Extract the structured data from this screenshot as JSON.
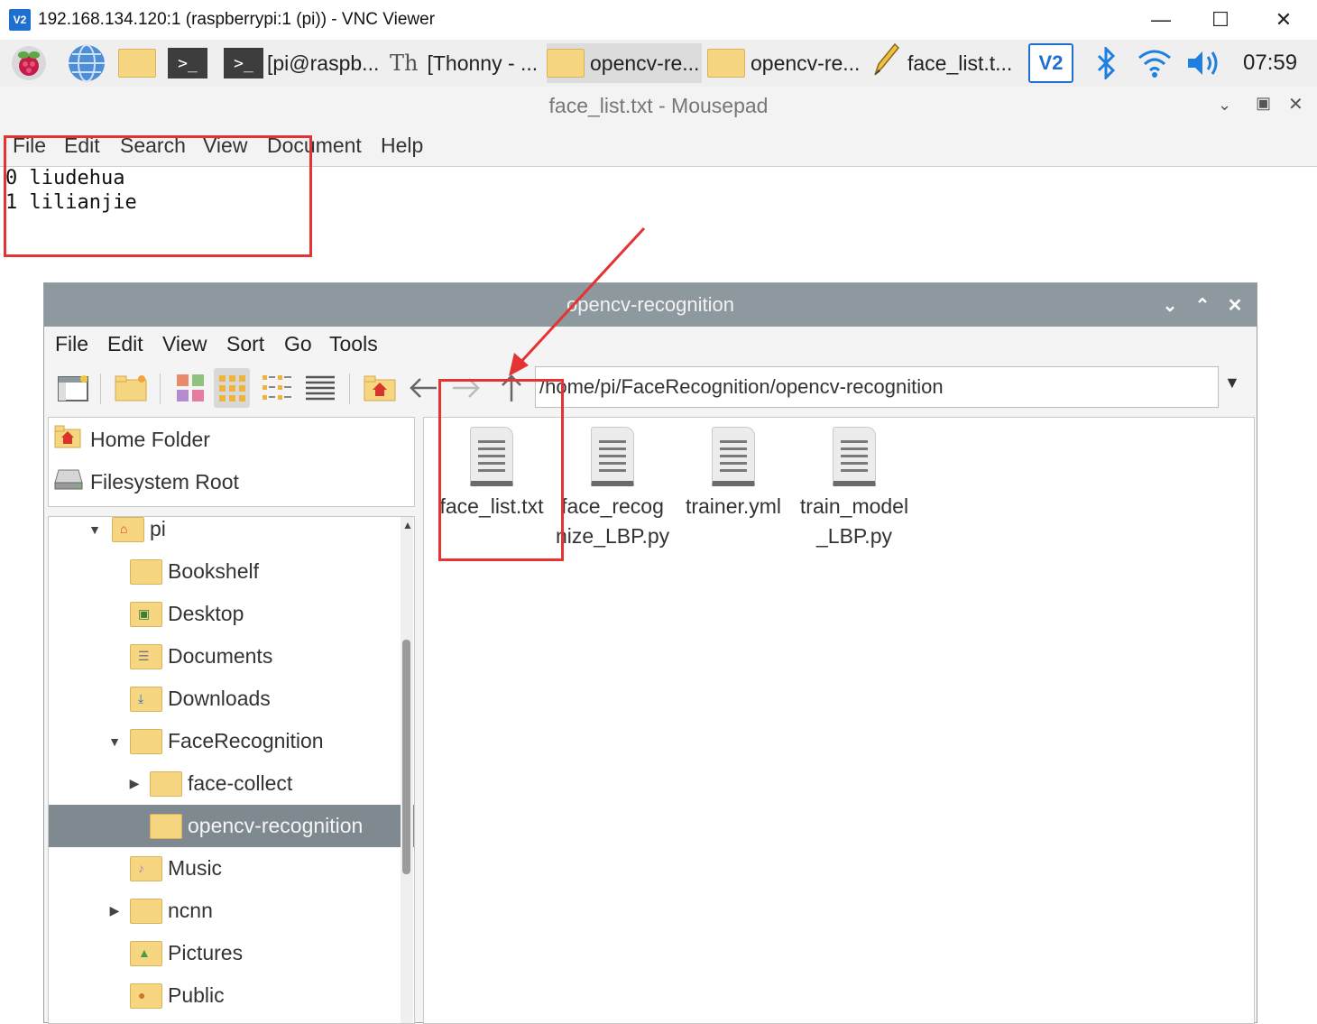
{
  "vnc": {
    "logo": "V2",
    "title": "192.168.134.120:1 (raspberrypi:1 (pi)) - VNC Viewer",
    "controls": [
      "minimize",
      "maximize",
      "close"
    ]
  },
  "taskbar": {
    "tasks": [
      {
        "label": "[pi@raspb...",
        "icon": "terminal-icon"
      },
      {
        "label": "[Thonny  - ...",
        "icon": "thonny-icon"
      },
      {
        "label": "opencv-re...",
        "icon": "folder-icon"
      },
      {
        "label": "opencv-re...",
        "icon": "folder-icon"
      },
      {
        "label": "face_list.t...",
        "icon": "pencil-icon"
      }
    ],
    "clock": "07:59"
  },
  "mousepad": {
    "title": "face_list.txt - Mousepad",
    "menu": [
      "File",
      "Edit",
      "Search",
      "View",
      "Document",
      "Help"
    ],
    "lines": [
      "0 liudehua",
      "1 lilianjie"
    ]
  },
  "filemanager": {
    "title": "opencv-recognition",
    "menu": [
      "File",
      "Edit",
      "View",
      "Sort",
      "Go",
      "Tools"
    ],
    "path": "/home/pi/FaceRecognition/opencv-recognition",
    "places": [
      "Home Folder",
      "Filesystem Root"
    ],
    "tree": [
      {
        "label": "pi",
        "icon": "home-icon"
      },
      {
        "label": "Bookshelf"
      },
      {
        "label": "Desktop"
      },
      {
        "label": "Documents"
      },
      {
        "label": "Downloads"
      },
      {
        "label": "FaceRecognition"
      },
      {
        "label": "face-collect"
      },
      {
        "label": "opencv-recognition"
      },
      {
        "label": "Music"
      },
      {
        "label": "ncnn"
      },
      {
        "label": "Pictures"
      },
      {
        "label": "Public"
      }
    ],
    "files": [
      {
        "line1": "face_list.txt",
        "line2": ""
      },
      {
        "line1": "face_recog",
        "line2": "nize_LBP.py"
      },
      {
        "line1": "trainer.yml",
        "line2": ""
      },
      {
        "line1": "train_model",
        "line2": "_LBP.py"
      }
    ]
  },
  "annotation_color": "#e53333"
}
